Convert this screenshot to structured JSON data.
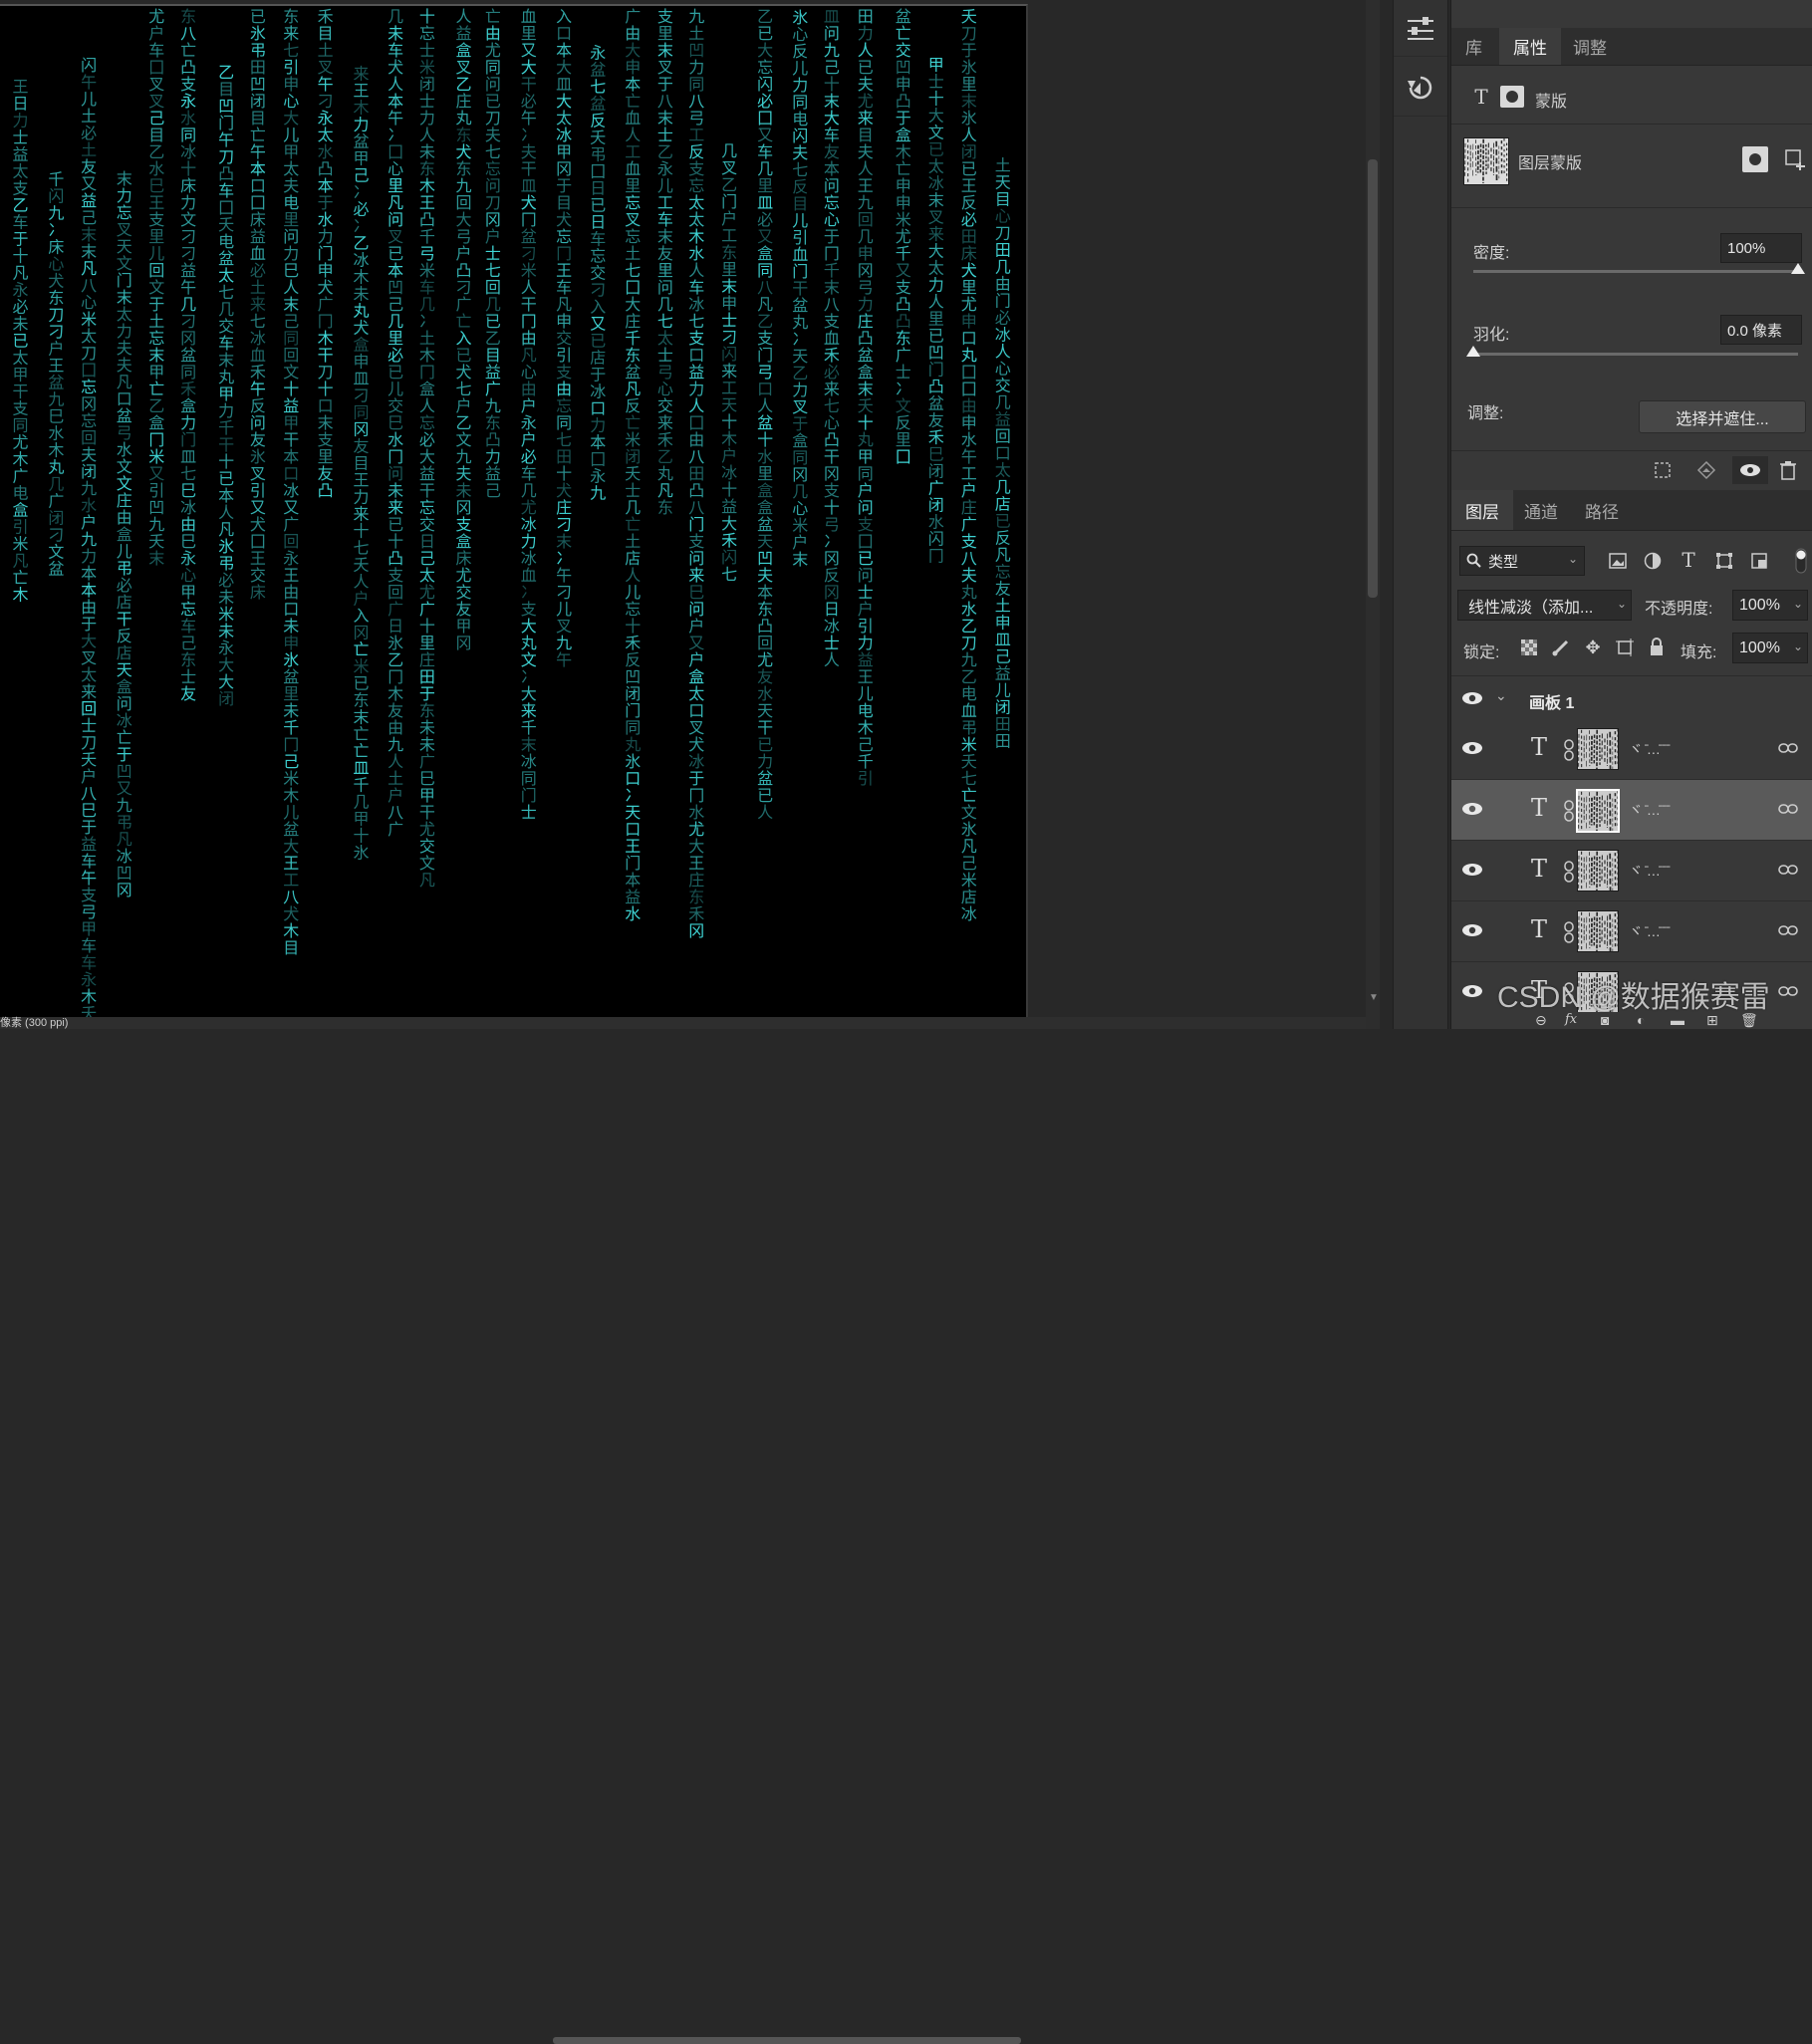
{
  "status": {
    "text": "像素 (300 ppi)"
  },
  "canvas": {
    "glyph_color": "#3fd6d6",
    "background": "#000000"
  },
  "tools": [
    {
      "icon": "adjustments-icon"
    },
    {
      "icon": "history-brush-icon"
    }
  ],
  "properties_panel": {
    "tabs": [
      {
        "label": "库"
      },
      {
        "label": "属性",
        "active": true
      },
      {
        "label": "调整"
      }
    ],
    "kind_label": "蒙版",
    "mask_title": "图层蒙版",
    "density": {
      "label": "密度:",
      "value": "100%",
      "level": 1.0
    },
    "feather": {
      "label": "羽化:",
      "value": "0.0 像素",
      "level": 0.0
    },
    "refine": {
      "label": "调整:",
      "button": "选择并遮住..."
    }
  },
  "layers_panel": {
    "tabs": [
      {
        "label": "图层",
        "active": true
      },
      {
        "label": "通道"
      },
      {
        "label": "路径"
      }
    ],
    "filter_kind": "类型",
    "blend_mode": "线性减淡（添加...",
    "opacity": {
      "label": "不透明度:",
      "value": "100%"
    },
    "lock": {
      "label": "锁定:"
    },
    "fill": {
      "label": "填充:",
      "value": "100%"
    },
    "group": {
      "name": "画板 1"
    },
    "layers": [
      {
        "name": "ヾ ̄…̄ ̄ ̄",
        "selected": false
      },
      {
        "name": "ヾ ̄…̄ ̄ ̄",
        "selected": true
      },
      {
        "name": "ヾ ̄…̄ ̄ ̄",
        "selected": false
      },
      {
        "name": "ヾ ̄…̄ ̄ ̄",
        "selected": false
      },
      {
        "name": "",
        "selected": false
      }
    ]
  },
  "watermark": "CSDN @数据猴赛雷"
}
